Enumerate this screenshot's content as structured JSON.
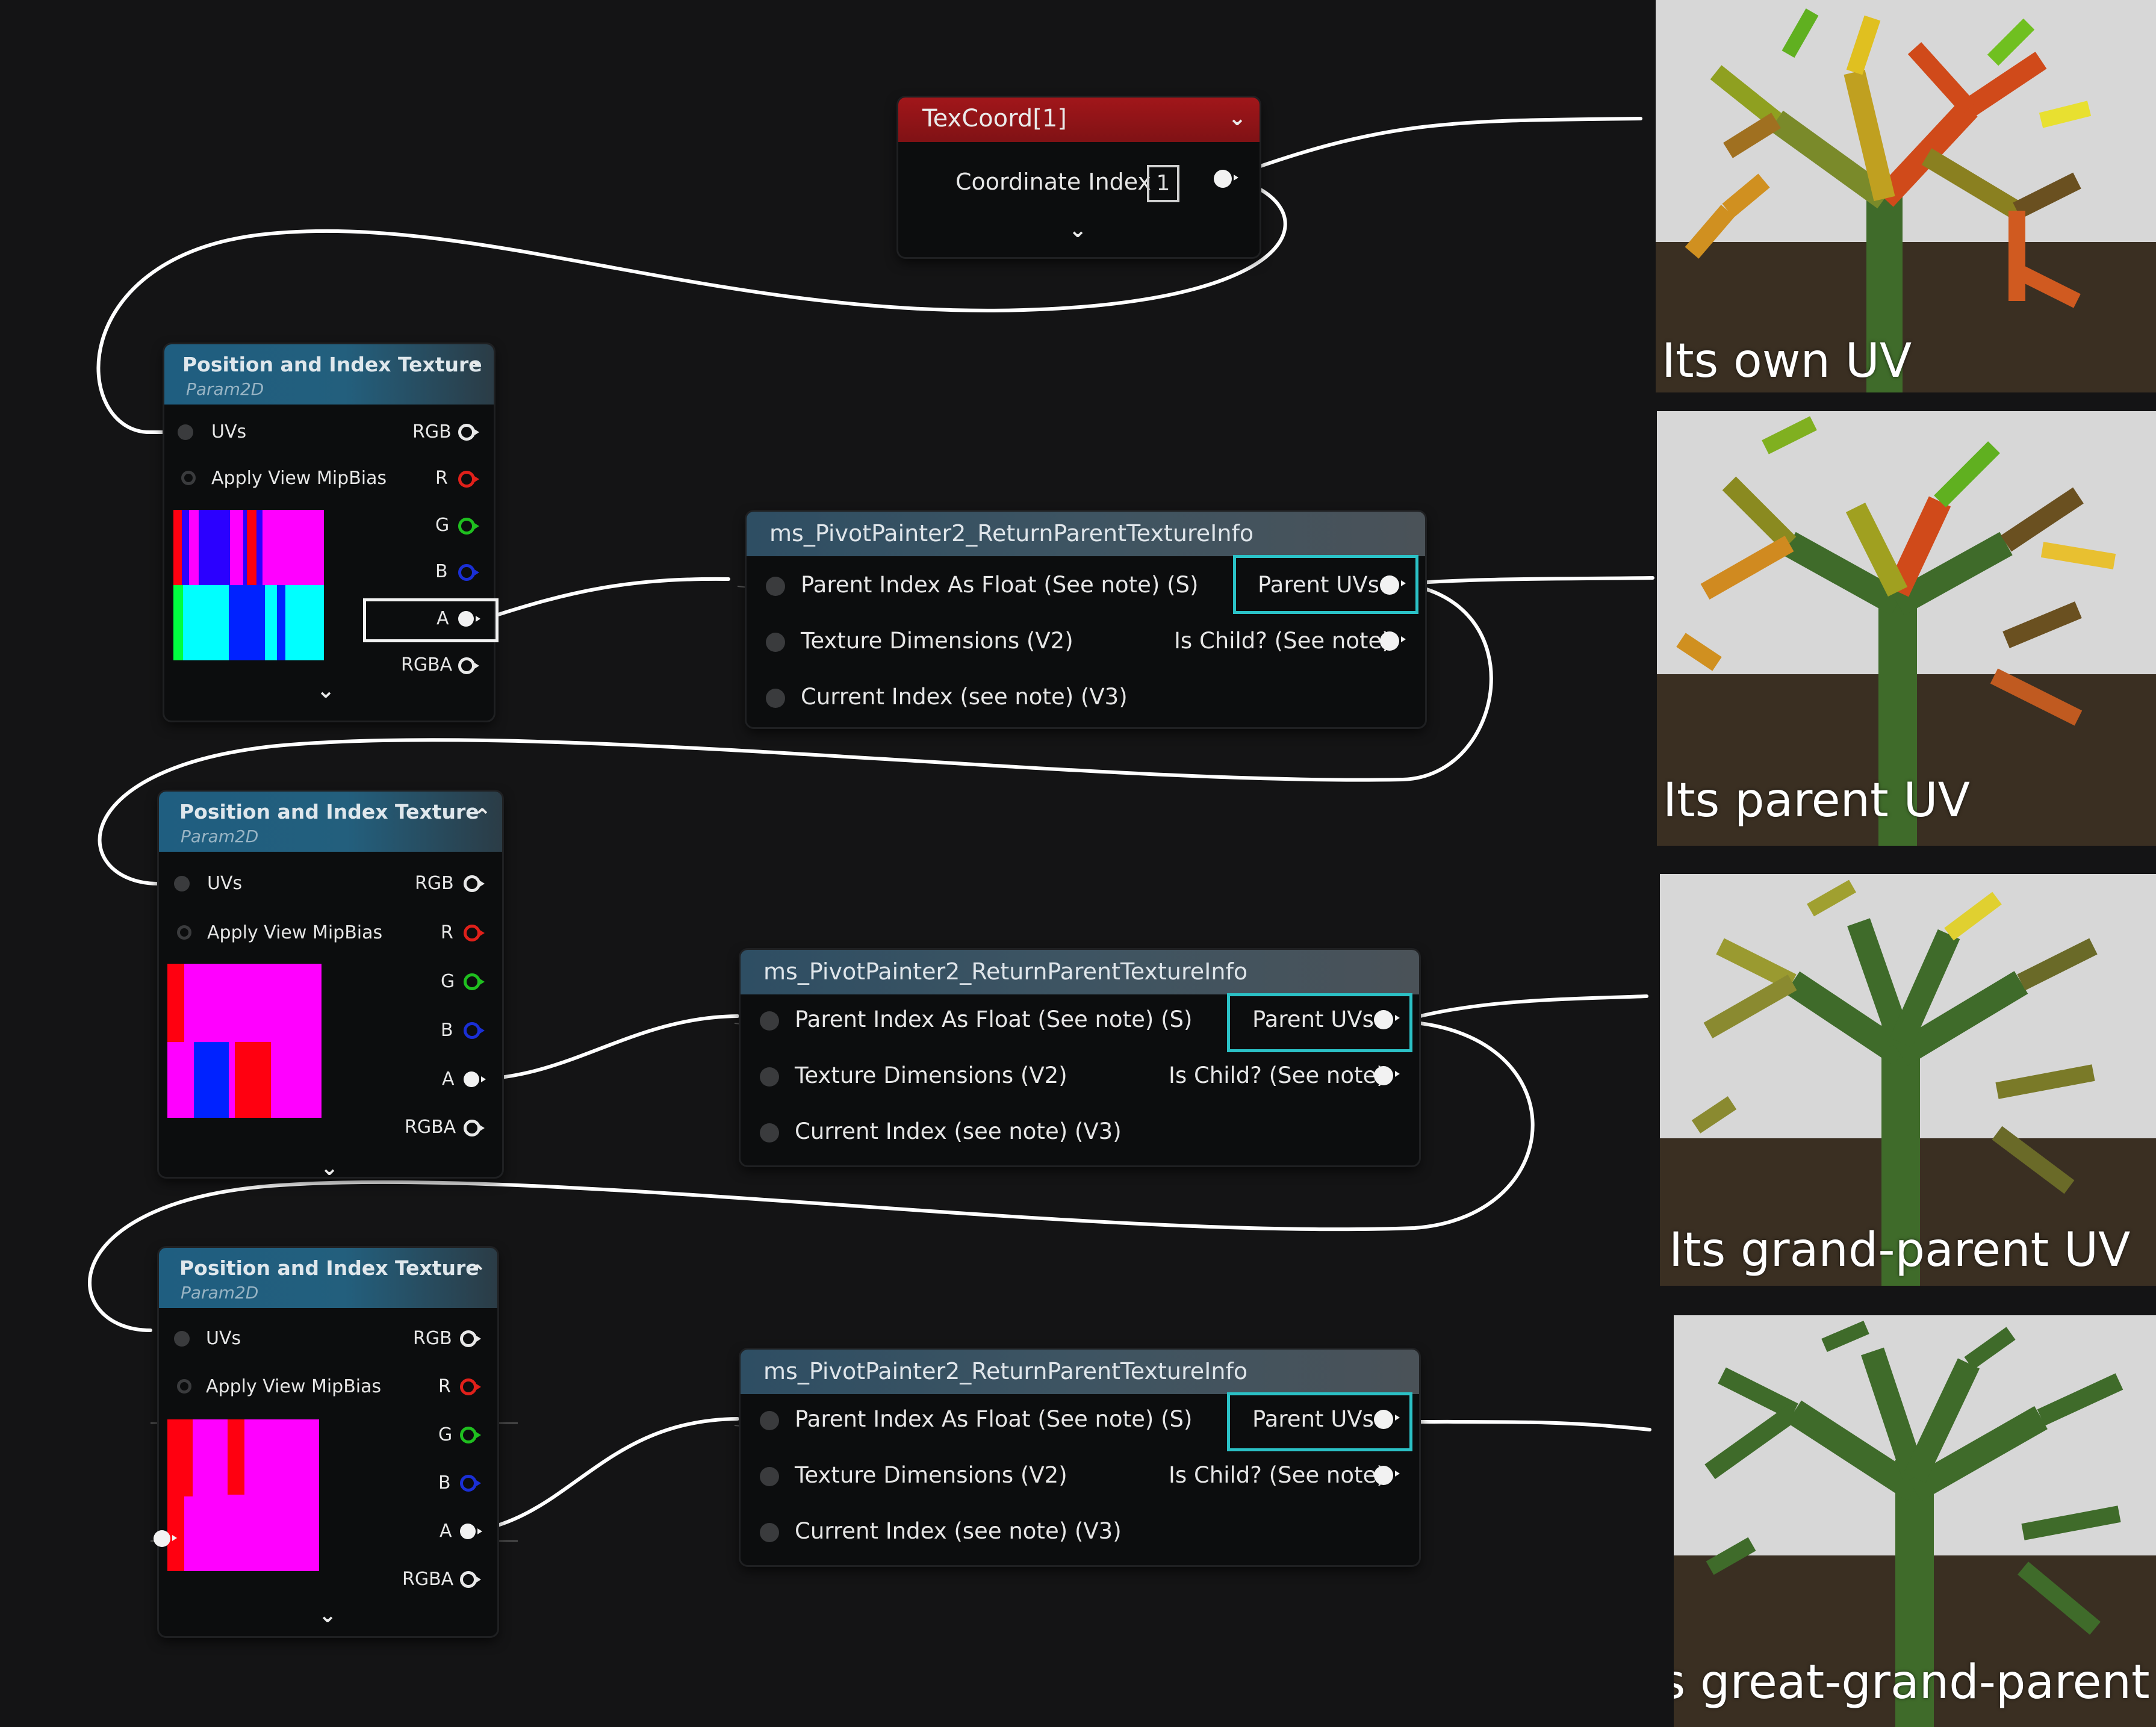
{
  "texcoord_node": {
    "title": "TexCoord[1]",
    "pin_label": "Coordinate Index",
    "index_value": "1"
  },
  "texture_nodes": [
    {
      "title": "Position and Index Texture",
      "subtitle": "Param2D",
      "inputs": [
        "UVs",
        "Apply View MipBias"
      ],
      "outputs": [
        "RGB",
        "R",
        "G",
        "B",
        "A",
        "RGBA"
      ]
    },
    {
      "title": "Position and Index Texture",
      "subtitle": "Param2D",
      "inputs": [
        "UVs",
        "Apply View MipBias"
      ],
      "outputs": [
        "RGB",
        "R",
        "G",
        "B",
        "A",
        "RGBA"
      ]
    },
    {
      "title": "Position and Index Texture",
      "subtitle": "Param2D",
      "inputs": [
        "UVs",
        "Apply View MipBias"
      ],
      "outputs": [
        "RGB",
        "R",
        "G",
        "B",
        "A",
        "RGBA"
      ]
    }
  ],
  "function_nodes": [
    {
      "title": "ms_PivotPainter2_ReturnParentTextureInfo",
      "inputs": [
        "Parent Index As Float (See note) (S)",
        "Texture Dimensions (V2)",
        "Current Index (see note) (V3)"
      ],
      "outputs": [
        "Parent UVs",
        "Is Child? (See note)"
      ]
    },
    {
      "title": "ms_PivotPainter2_ReturnParentTextureInfo",
      "inputs": [
        "Parent Index As Float (See note) (S)",
        "Texture Dimensions (V2)",
        "Current Index (see note) (V3)"
      ],
      "outputs": [
        "Parent UVs",
        "Is Child? (See note)"
      ]
    },
    {
      "title": "ms_PivotPainter2_ReturnParentTextureInfo",
      "inputs": [
        "Parent Index As Float (See note) (S)",
        "Texture Dimensions (V2)",
        "Current Index (see note) (V3)"
      ],
      "outputs": [
        "Parent UVs",
        "Is Child? (See note)"
      ]
    }
  ],
  "captions": [
    "Its own UV",
    "Its parent UV",
    "Its grand-parent UV",
    "Its great-grand-parent UV"
  ],
  "colors": {
    "background": "#141415",
    "wire": "#ffffff",
    "highlight": "#2bc1c6",
    "texcoord_header": "#a1161a",
    "texture_header": "#1f5e80",
    "pin_r": "#e0201a",
    "pin_g": "#1fbf1f",
    "pin_b": "#1a2fd6",
    "tree_trunk": "#3f6b2a",
    "ground": "#3a2f22"
  }
}
